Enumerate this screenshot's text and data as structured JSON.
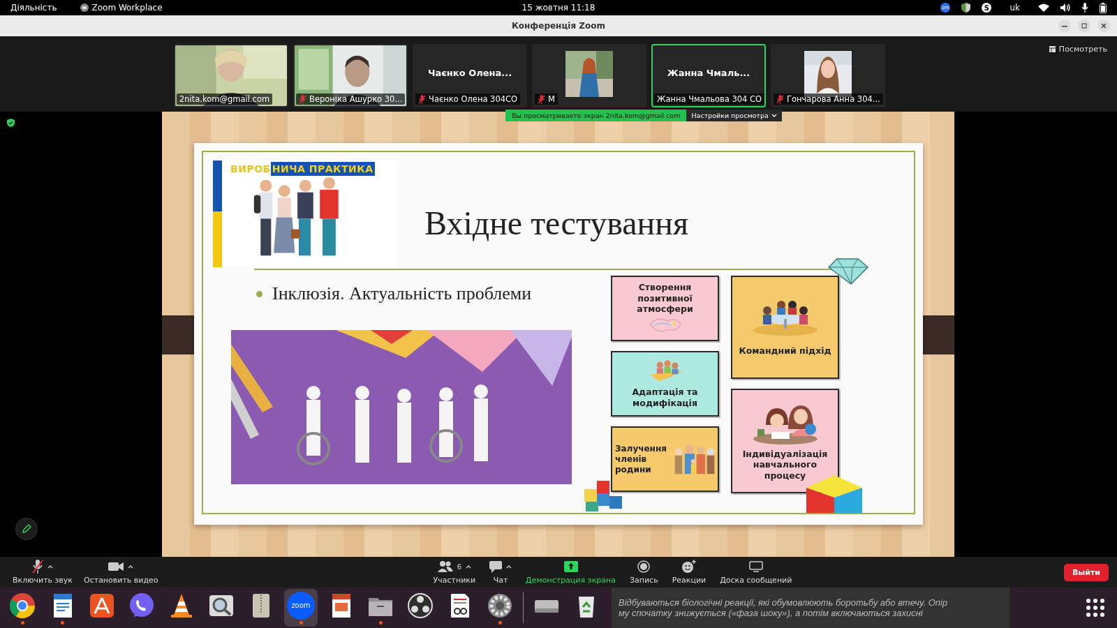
{
  "top_bar": {
    "activities": "Діяльність",
    "app": "Zoom Workplace",
    "clock": "15 жовтня  11:18",
    "tray_app": "zm",
    "skype": "S",
    "language": "uk"
  },
  "window": {
    "title": "Конференція Zoom"
  },
  "view_button": "Посмотреть",
  "participants": [
    {
      "kind": "video",
      "name": "2nita.kom@gmail.com",
      "muted": false,
      "selected": false
    },
    {
      "kind": "video",
      "name": "Вероніка Ашурко 30...",
      "muted": true,
      "selected": false
    },
    {
      "kind": "name",
      "heading": "Чаєнко Олена...",
      "name": "Чаєнко Олена 304СО",
      "muted": true,
      "selected": false
    },
    {
      "kind": "avatar",
      "name": "М",
      "muted": true,
      "selected": false
    },
    {
      "kind": "name",
      "heading": "Жанна Чмаль...",
      "name": "Жанна Чмальова 304 СО",
      "muted": false,
      "selected": true
    },
    {
      "kind": "avatar",
      "name": "Гончарова Анна 304...",
      "muted": true,
      "selected": false
    }
  ],
  "share_notice": {
    "text": "Вы просматриваете экран 2nita.kom@gmail.com",
    "options": "Настройки просмотра"
  },
  "slide": {
    "banner_left": "ВИРОБ",
    "banner_right": "НИЧА ПРАКТИКА",
    "title": "Вхідне тестування",
    "bullets": [
      "Інклюзія. Актуальність проблеми"
    ],
    "card_columns": [
      [
        {
          "text": "Створення позитивної атмосфери",
          "color": "#f9c9d2",
          "kind": "picture-below"
        },
        {
          "text": "Адаптація та модифікація",
          "color": "#ade9e1",
          "kind": "picture-above"
        },
        {
          "text": "Залучення членів родини",
          "color": "#f5ca6c",
          "kind": "picture-beside"
        }
      ],
      [
        {
          "text": "Командний підхід",
          "color": "#f5ca6c",
          "kind": "picture-above"
        },
        {
          "text": "Індивідуалізація навчального процесу",
          "color": "#f9c9d2",
          "kind": "picture-above"
        }
      ]
    ]
  },
  "toolbar_left": [
    {
      "kind": "mic",
      "label": "Включить звук",
      "caret": true
    },
    {
      "kind": "video",
      "label": "Остановить видео",
      "caret": true
    }
  ],
  "toolbar_center": [
    {
      "kind": "participants",
      "label": "Участники",
      "count": "6",
      "caret": true
    },
    {
      "kind": "chat",
      "label": "Чат",
      "caret": true
    },
    {
      "kind": "share",
      "label": "Демонстрация экрана",
      "caret": false
    },
    {
      "kind": "record",
      "label": "Запись",
      "caret": false
    },
    {
      "kind": "reactions",
      "label": "Реакции",
      "caret": false
    },
    {
      "kind": "whiteboard",
      "label": "Доска сообщений",
      "caret": false
    }
  ],
  "leave_button": "Выйти",
  "dock": [
    {
      "kind": "browser",
      "running": true,
      "selected": false
    },
    {
      "kind": "writer",
      "running": true,
      "selected": false
    },
    {
      "kind": "store",
      "running": false,
      "selected": false
    },
    {
      "kind": "viber",
      "running": false,
      "selected": false
    },
    {
      "kind": "vlc",
      "running": false,
      "selected": false
    },
    {
      "kind": "viewer",
      "running": false,
      "selected": false
    },
    {
      "kind": "archive",
      "running": false,
      "selected": false
    },
    {
      "kind": "zoom",
      "label": "zoom",
      "running": true,
      "selected": true
    },
    {
      "kind": "impress",
      "running": false,
      "selected": false
    },
    {
      "kind": "files",
      "running": true,
      "selected": false
    },
    {
      "kind": "obs",
      "running": false,
      "selected": false
    },
    {
      "kind": "document",
      "running": false,
      "selected": false
    },
    {
      "kind": "settings",
      "running": true,
      "selected": false
    },
    {
      "kind": "separator"
    },
    {
      "kind": "drive",
      "running": false,
      "selected": false
    },
    {
      "kind": "trash",
      "running": false,
      "selected": false
    }
  ],
  "document_lines": [
    "Відбуваються біологічні реакції, які обумовлюють боротьбу або втечу. Опір",
    "му спочатку знижується («фаза шоку»), а потім включаються захисні"
  ]
}
